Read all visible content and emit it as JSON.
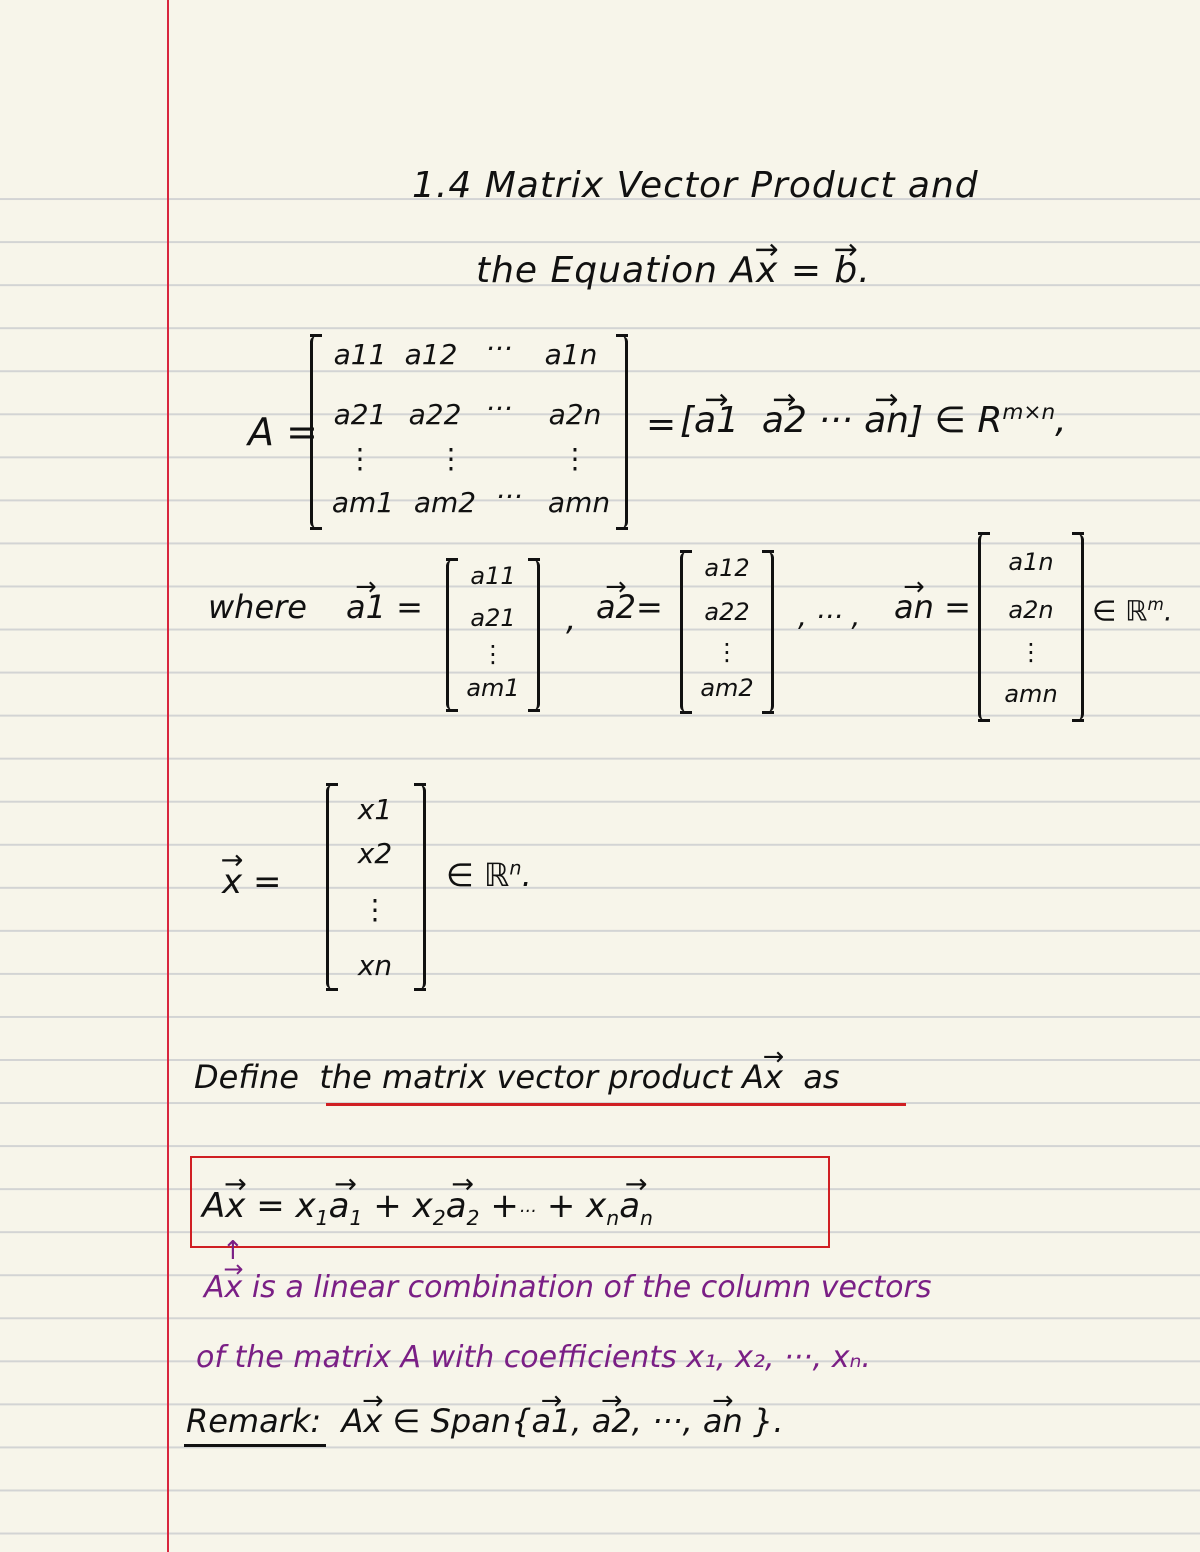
{
  "page": {
    "paper_color": "#f7f5ea",
    "rule_color": "#d3d4d4",
    "margin_color": "#d8263e"
  },
  "title": {
    "line1": "1.4 Matrix Vector Product and",
    "line2_text": "the Equation ",
    "line2_A": "A",
    "line2_x": "x",
    "line2_eq": " = ",
    "line2_b": "b",
    "line2_end": "."
  },
  "matrix_A": {
    "label": "A =",
    "rows": [
      [
        "a11",
        "a12",
        "···",
        "a1n"
      ],
      [
        "a21",
        "a22",
        "···",
        "a2n"
      ],
      [
        "⋮",
        "⋮",
        "",
        "⋮"
      ],
      [
        "am1",
        "am2",
        "···",
        "amn"
      ]
    ],
    "equals": "=",
    "columns_form": [
      "a1",
      "a2",
      "···",
      "an"
    ],
    "membership": "∈ R",
    "membership_sup": "m×n",
    "trailing": ","
  },
  "columns_def": {
    "where": "where",
    "vectors": [
      {
        "name": "a1",
        "entries": [
          "a11",
          "a21",
          "⋮",
          "am1"
        ]
      },
      {
        "name": "a2",
        "entries": [
          "a12",
          "a22",
          "⋮",
          "am2"
        ]
      },
      {
        "name": "an",
        "entries": [
          "a1n",
          "a2n",
          "⋮",
          "amn"
        ]
      }
    ],
    "separator1": ",",
    "separator2": ", ··· ,",
    "membership": "∈ ℝ",
    "membership_sup": "m",
    "end": "."
  },
  "vector_x": {
    "name": "x",
    "equals": "=",
    "entries": [
      "x1",
      "x2",
      "⋮",
      "xn"
    ],
    "membership": "∈ ℝ",
    "membership_sup": "n",
    "end": "."
  },
  "definition": {
    "prefix": "Define",
    "underlined": "the matrix vector product A",
    "underlined_vec": "x",
    "suffix": "as"
  },
  "boxed_equation": {
    "lhs_A": "A",
    "lhs_x": "x",
    "eq": "=",
    "terms": [
      {
        "coef": "x",
        "coef_sub": "1",
        "vec": "a",
        "vec_sub": "1"
      },
      {
        "coef": "x",
        "coef_sub": "2",
        "vec": "a",
        "vec_sub": "2"
      },
      {
        "ellipsis": "···"
      },
      {
        "coef": "x",
        "coef_sub": "n",
        "vec": "a",
        "vec_sub": "n"
      }
    ],
    "plus": "+"
  },
  "annotation": {
    "color": "#7a1f85",
    "arrow": "↑",
    "line1_A": "A",
    "line1_x": "x",
    "line1_rest": " is a linear combination of the column vectors",
    "line2": "of the matrix A with coefficients x₁, x₂, ···, xₙ."
  },
  "remark": {
    "label": "Remark:",
    "A": "A",
    "x": "x",
    "in_span": " ∈ Span{",
    "vectors": [
      "a1",
      "a2",
      "an"
    ],
    "sep": ", ",
    "ellipsis": "···",
    "close": "}."
  }
}
